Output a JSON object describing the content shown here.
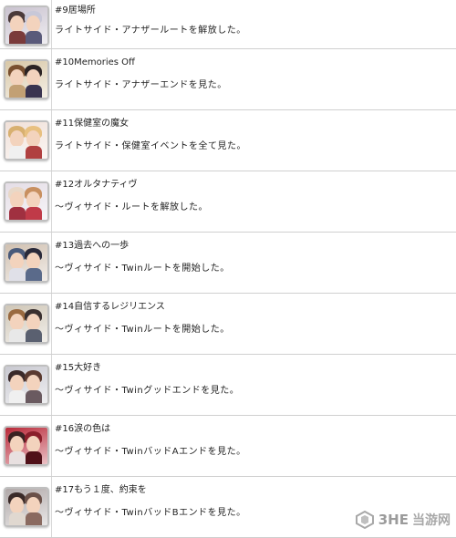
{
  "entries": [
    {
      "title": "#9居場所",
      "desc": "ライトサイド・アナザールートを解放した。",
      "colors": {
        "bg": "#c9c2cf",
        "hair1": "#4a3a3a",
        "hair2": "#c8c8d8",
        "body1": "#7a3b3b",
        "body2": "#5a5a7a"
      }
    },
    {
      "title": "#10Memories Off",
      "desc": "ライトサイド・アナザーエンドを見た。",
      "colors": {
        "bg": "#d8c7a6",
        "hair1": "#7a5030",
        "hair2": "#2c2424",
        "body1": "#c2a074",
        "body2": "#3a3450"
      }
    },
    {
      "title": "#11保健室の魔女",
      "desc": "ライトサイド・保健室イベントを全て見た。",
      "colors": {
        "bg": "#f0e0d8",
        "hair1": "#d8b070",
        "hair2": "#e8c080",
        "body1": "#f0f0f0",
        "body2": "#b04040"
      }
    },
    {
      "title": "#12オルタナティヴ",
      "desc": "～ヴィサイド・ルートを解放した。",
      "colors": {
        "bg": "#e4dde6",
        "hair1": "#e8d8c8",
        "hair2": "#c89060",
        "body1": "#a03040",
        "body2": "#c03a48"
      }
    },
    {
      "title": "#13過去への一歩",
      "desc": "～ヴィサイド・Twinルートを開始した。",
      "colors": {
        "bg": "#d0c0b0",
        "hair1": "#4a5a7a",
        "hair2": "#2a2a3a",
        "body1": "#e0e0e8",
        "body2": "#5a6a8a"
      }
    },
    {
      "title": "#14自信するレジリエンス",
      "desc": "～ヴィサイド・Twinルートを開始した。",
      "colors": {
        "bg": "#cfc6b6",
        "hair1": "#9a6a40",
        "hair2": "#3a3030",
        "body1": "#e8e8e8",
        "body2": "#5a6070"
      }
    },
    {
      "title": "#15大好き",
      "desc": "～ヴィサイド・Twinグッドエンドを見た。",
      "colors": {
        "bg": "#c8c8d0",
        "hair1": "#3a2a2a",
        "hair2": "#5a3a30",
        "body1": "#f0f0f0",
        "body2": "#6a5a60"
      }
    },
    {
      "title": "#16涙の色は",
      "desc": "～ヴィサイド・TwinバッドAエンドを見た。",
      "colors": {
        "bg": "#b82838",
        "hair1": "#3a2222",
        "hair2": "#8a1e2a",
        "body1": "#e8e0e0",
        "body2": "#501018"
      }
    },
    {
      "title": "#17もう１度、約束を",
      "desc": "～ヴィサイド・TwinバッドBエンドを見た。",
      "colors": {
        "bg": "#b0a8a8",
        "hair1": "#3a2a28",
        "hair2": "#6a5048",
        "body1": "#e0d8d0",
        "body2": "#8a6a60"
      }
    }
  ],
  "watermark": {
    "brand": "3HE",
    "site": "当游网",
    "logo_color": "#9a9a9a"
  }
}
